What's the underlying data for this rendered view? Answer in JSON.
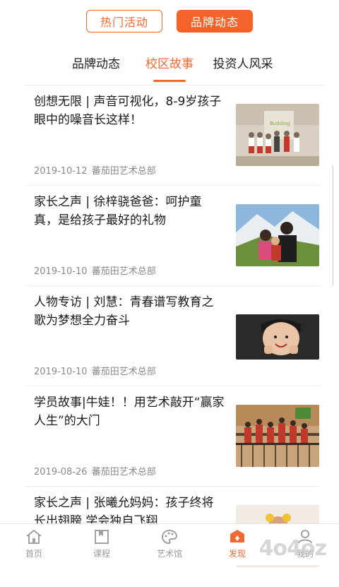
{
  "top_toggle": {
    "hot_activities": "热门活动",
    "brand_news": "品牌动态"
  },
  "tabs": [
    {
      "label": "品牌动态"
    },
    {
      "label": "校区故事"
    },
    {
      "label": "投资人风采"
    }
  ],
  "articles": [
    {
      "title": "创想无限 | 声音可视化，8-9岁孩子眼中的噪音长这样！",
      "date": "2019-10-12",
      "source": "蕃茄田艺术总部"
    },
    {
      "title": "家长之声 | 徐梓骁爸爸：呵护童真，是给孩子最好的礼物",
      "date": "2019-10-10",
      "source": "蕃茄田艺术总部"
    },
    {
      "title": "人物专访 | 刘慧：青春谱写教育之歌为梦想全力奋斗",
      "date": "2019-10-10",
      "source": "蕃茄田艺术总部"
    },
    {
      "title": "学员故事|牛娃！！用艺术敲开“赢家人生”的大门",
      "date": "2019-08-26",
      "source": "蕃茄田艺术总部"
    },
    {
      "title": "家长之声 | 张曦允妈妈：孩子终将长出翅膀 学会独自飞翔",
      "date": "",
      "source": ""
    }
  ],
  "bottom_nav": [
    {
      "label": "首页",
      "icon": "home-icon"
    },
    {
      "label": "课程",
      "icon": "course-icon"
    },
    {
      "label": "艺术馆",
      "icon": "palette-icon"
    },
    {
      "label": "发现",
      "icon": "discover-icon"
    },
    {
      "label": "我的",
      "icon": "user-icon"
    }
  ],
  "watermark": "4o4oz",
  "colors": {
    "accent": "#f06a32",
    "text": "#1a1a1a",
    "meta": "#8a8a8a",
    "nav_inactive": "#9a9a9a"
  }
}
